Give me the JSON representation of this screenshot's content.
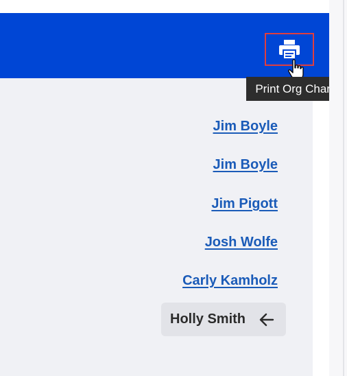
{
  "header": {
    "brand_color": "#0046d5",
    "print_button": {
      "icon": "printer-icon",
      "tooltip": "Print Org Chart"
    }
  },
  "people": [
    {
      "name": "Jim Boyle"
    },
    {
      "name": "Jim Boyle"
    },
    {
      "name": "Jim Pigott"
    },
    {
      "name": "Josh Wolfe"
    },
    {
      "name": "Carly Kamholz"
    }
  ],
  "current_person": {
    "name": "Holly Smith",
    "icon": "arrow-left-icon"
  },
  "colors": {
    "link": "#1a5bb8",
    "highlight_border": "#e03e3e",
    "tooltip_bg": "#2d2d2d",
    "panel_bg": "#f0f1f5"
  }
}
